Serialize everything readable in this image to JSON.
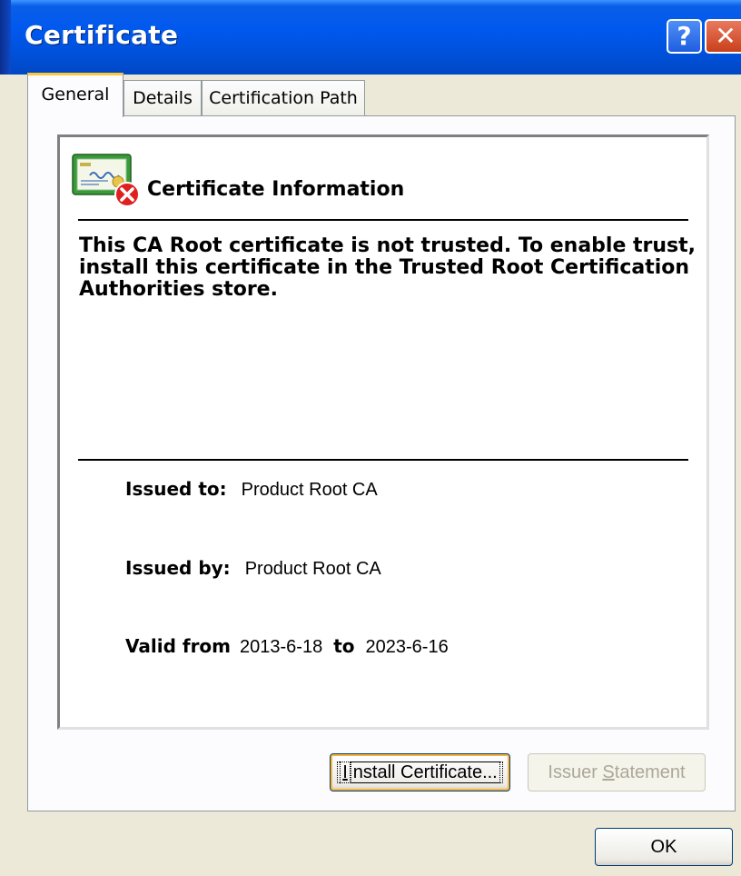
{
  "window": {
    "title": "Certificate"
  },
  "titlebar": {
    "help_label": "?",
    "close_label": "✕",
    "icons": [
      "help-icon",
      "close-icon"
    ]
  },
  "tabs": [
    {
      "label": "General",
      "active": true
    },
    {
      "label": "Details",
      "active": false
    },
    {
      "label": "Certification Path",
      "active": false
    }
  ],
  "info": {
    "icon": "certificate-error-icon",
    "heading": "Certificate Information",
    "message": "This CA Root certificate is not trusted. To enable trust, install this certificate in the Trusted Root Certification Authorities store."
  },
  "details": {
    "issued_to_label": "Issued to:",
    "issued_to_value": "Product Root CA",
    "issued_by_label": "Issued by:",
    "issued_by_value": "Product Root CA",
    "valid_from_label": "Valid from",
    "valid_from_value": "2013-6-18",
    "valid_to_label": "to",
    "valid_to_value": "2023-6-16"
  },
  "buttons": {
    "install_prefix": "I",
    "install_rest": "nstall Certificate...",
    "issuer_prefix": "Issuer ",
    "issuer_underlined": "S",
    "issuer_rest": "tatement",
    "issuer_enabled": false,
    "ok": "OK"
  },
  "colors": {
    "titlebar": "#0058ee",
    "active_tab_accent": "#ffc83c",
    "dialog_face": "#ece9d8",
    "error_badge": "#e02020"
  }
}
